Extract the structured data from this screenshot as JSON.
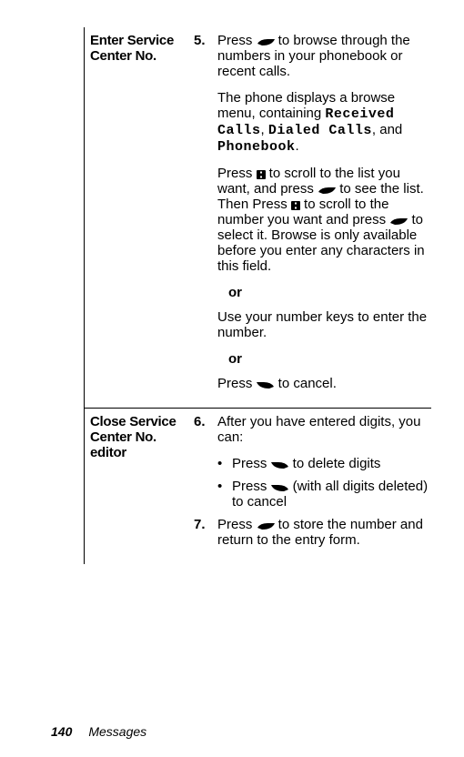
{
  "sections": {
    "enter": {
      "label": "Enter Service Center No.",
      "step5_num": "5.",
      "step5_a": "Press ",
      "step5_b": " to browse through the numbers in your phonebook or recent calls.",
      "p2_a": "The phone displays a browse menu, containing ",
      "rc": "Received Calls",
      "comma1": ", ",
      "dc": "Dialed Calls",
      "comma2": ", and ",
      "pb": "Phonebook",
      "dot2": ".",
      "p3_a": "Press ",
      "p3_b": " to scroll to the list you want, and press ",
      "p3_c": " to see the list. Then Press ",
      "p3_d": " to scroll to the number you want and press ",
      "p3_e": " to select it. Browse is only available before you enter any characters in this field.",
      "or1": "or",
      "p4": "Use your number keys to enter the number.",
      "or2": "or",
      "p5_a": "Press ",
      "p5_b": " to cancel."
    },
    "close": {
      "label": "Close Service Center No. editor",
      "step6_num": "6.",
      "step6_txt": "After you have entered digits, you can:",
      "b1_a": "Press ",
      "b1_b": " to delete digits",
      "b2_a": "Press ",
      "b2_b": " (with all digits deleted) to cancel",
      "step7_num": "7.",
      "step7_a": "Press ",
      "step7_b": " to store the number and return to the entry form."
    }
  },
  "footer": {
    "page": "140",
    "title": "Messages"
  }
}
